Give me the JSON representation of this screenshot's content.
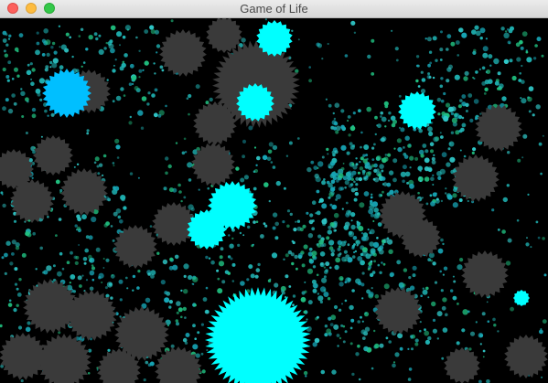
{
  "window": {
    "title": "Game of Life"
  },
  "colors": {
    "background": "#000000",
    "dormant_cell": "#3a3a3a",
    "alive_cell": "#00ffff",
    "alive_cell_alt": "#00bfff",
    "particle_primary": "#1fb3b3",
    "particle_secondary": "#20c080"
  },
  "icons": {
    "close": "close-dot",
    "minimize": "minimize-dot",
    "zoom": "zoom-dot"
  }
}
